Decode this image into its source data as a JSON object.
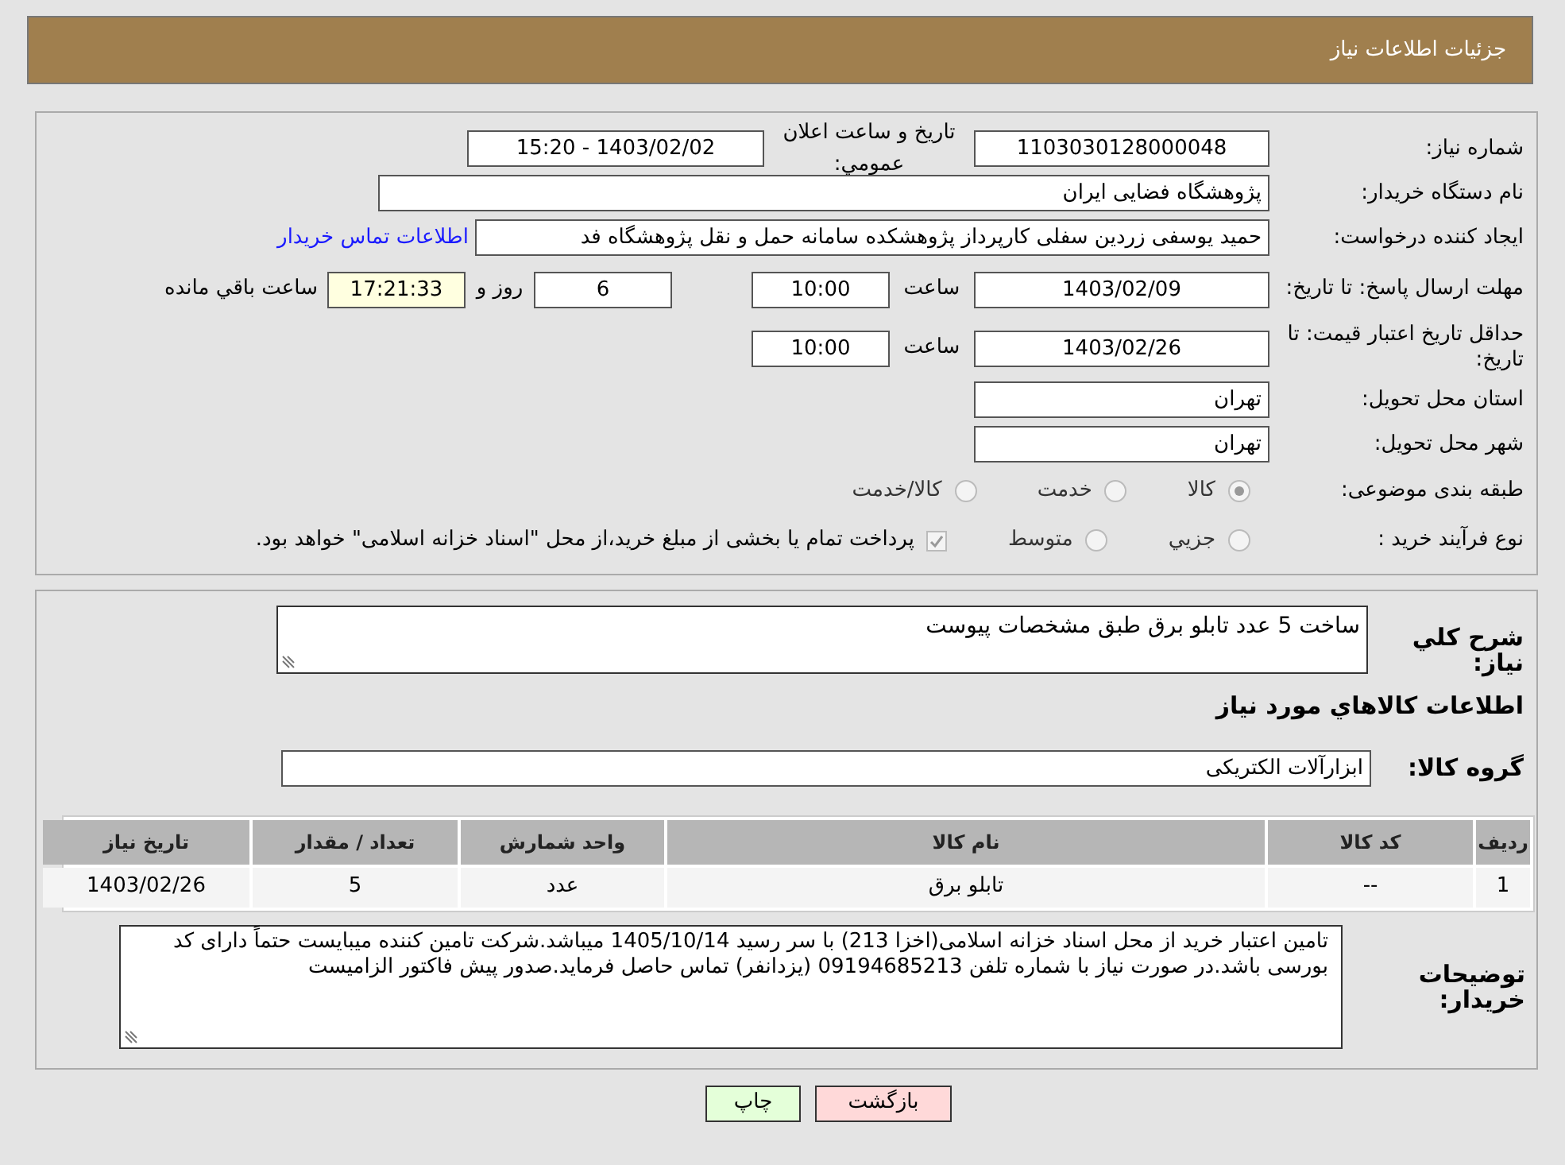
{
  "header": {
    "title": "جزئیات اطلاعات نیاز"
  },
  "details": {
    "need_number": {
      "label": "شماره نیاز:",
      "value": "1103030128000048"
    },
    "announce": {
      "label": "تاریخ و ساعت اعلان عمومي:",
      "value": "1403/02/02 - 15:20"
    },
    "buyer_org": {
      "label": "نام دستگاه خريدار:",
      "value": "پژوهشگاه فضايی ايران"
    },
    "requester": {
      "label": "ايجاد کننده درخواست:",
      "value": "حميد يوسفی زردين سفلی کارپرداز پژوهشکده سامانه حمل و نقل پژوهشگاه فد",
      "link": "اطلاعات تماس خريدار"
    },
    "deadline": {
      "label": "مهلت ارسال پاسخ: تا تاريخ:",
      "date": "1403/02/09",
      "time_label": "ساعت",
      "time": "10:00",
      "days": "6",
      "days_label": "روز و",
      "remaining": "17:21:33",
      "remaining_label": "ساعت باقي مانده"
    },
    "validity": {
      "label": "حداقل تاريخ اعتبار قيمت: تا تاريخ:",
      "date": "1403/02/26",
      "time_label": "ساعت",
      "time": "10:00"
    },
    "province": {
      "label": "استان محل تحويل:",
      "value": "تهران"
    },
    "city": {
      "label": "شهر محل تحويل:",
      "value": "تهران"
    },
    "category": {
      "label": "طبقه بندی موضوعی:",
      "options": [
        {
          "label": "کالا",
          "selected": true
        },
        {
          "label": "خدمت",
          "selected": false
        },
        {
          "label": "کالا/خدمت",
          "selected": false
        }
      ]
    },
    "process": {
      "label": "نوع فرآيند خريد :",
      "options": [
        {
          "label": "جزيي",
          "selected": false
        },
        {
          "label": "متوسط",
          "selected": false
        }
      ],
      "treasury": {
        "checked": true,
        "text": "پرداخت تمام يا بخشی از مبلغ خريد،از محل \"اسناد خزانه اسلامی\" خواهد بود."
      }
    }
  },
  "goods": {
    "description": {
      "label": "شرح کلي نياز:",
      "value": "ساخت 5 عدد تابلو برق طبق مشخصات پيوست"
    },
    "heading": "اطلاعات کالاهاي مورد نياز",
    "group": {
      "label": "گروه کالا:",
      "value": "ابزارآلات الکتريکی"
    },
    "table": {
      "columns": [
        "رديف",
        "کد کالا",
        "نام کالا",
        "واحد شمارش",
        "تعداد / مقدار",
        "تاريخ نياز"
      ],
      "rows": [
        [
          "1",
          "--",
          "تابلو برق",
          "عدد",
          "5",
          "1403/02/26"
        ]
      ]
    },
    "notes": {
      "label": "توضيحات خريدار:",
      "value": "تامين اعتبار خريد از محل اسناد خزانه اسلامی(اخزا 213) با سر رسيد 1405/10/14 ميباشد.شرکت تامين کننده ميبايست حتماً دارای کد بورسی باشد.در صورت نياز با شماره تلفن 09194685213 (يزدانفر) تماس حاصل فرمايد.صدور پيش فاکتور الزاميست"
    }
  },
  "buttons": [
    {
      "label": "بازگشت",
      "kind": "back"
    },
    {
      "label": "چاپ",
      "kind": "print"
    }
  ]
}
